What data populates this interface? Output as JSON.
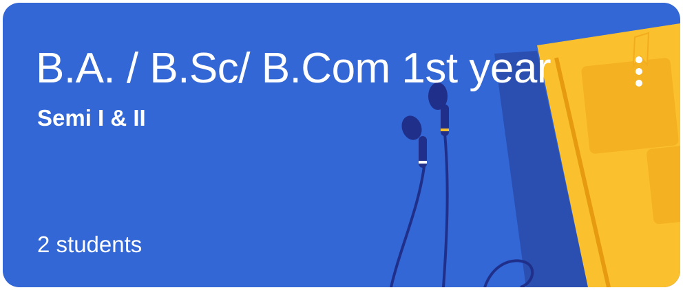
{
  "card": {
    "title": "B.A. / B.Sc/ B.Com 1st year",
    "section": "Semi I & II",
    "student_count": "2 students",
    "more_icon": "more-vert-icon",
    "background_color": "#3367d6",
    "illustration": {
      "name": "notebook-and-earphones",
      "notebook_color": "#fbc02d",
      "notebook_shadow_color": "#2a4fb0",
      "earphones_color": "#1f2f8a"
    }
  }
}
